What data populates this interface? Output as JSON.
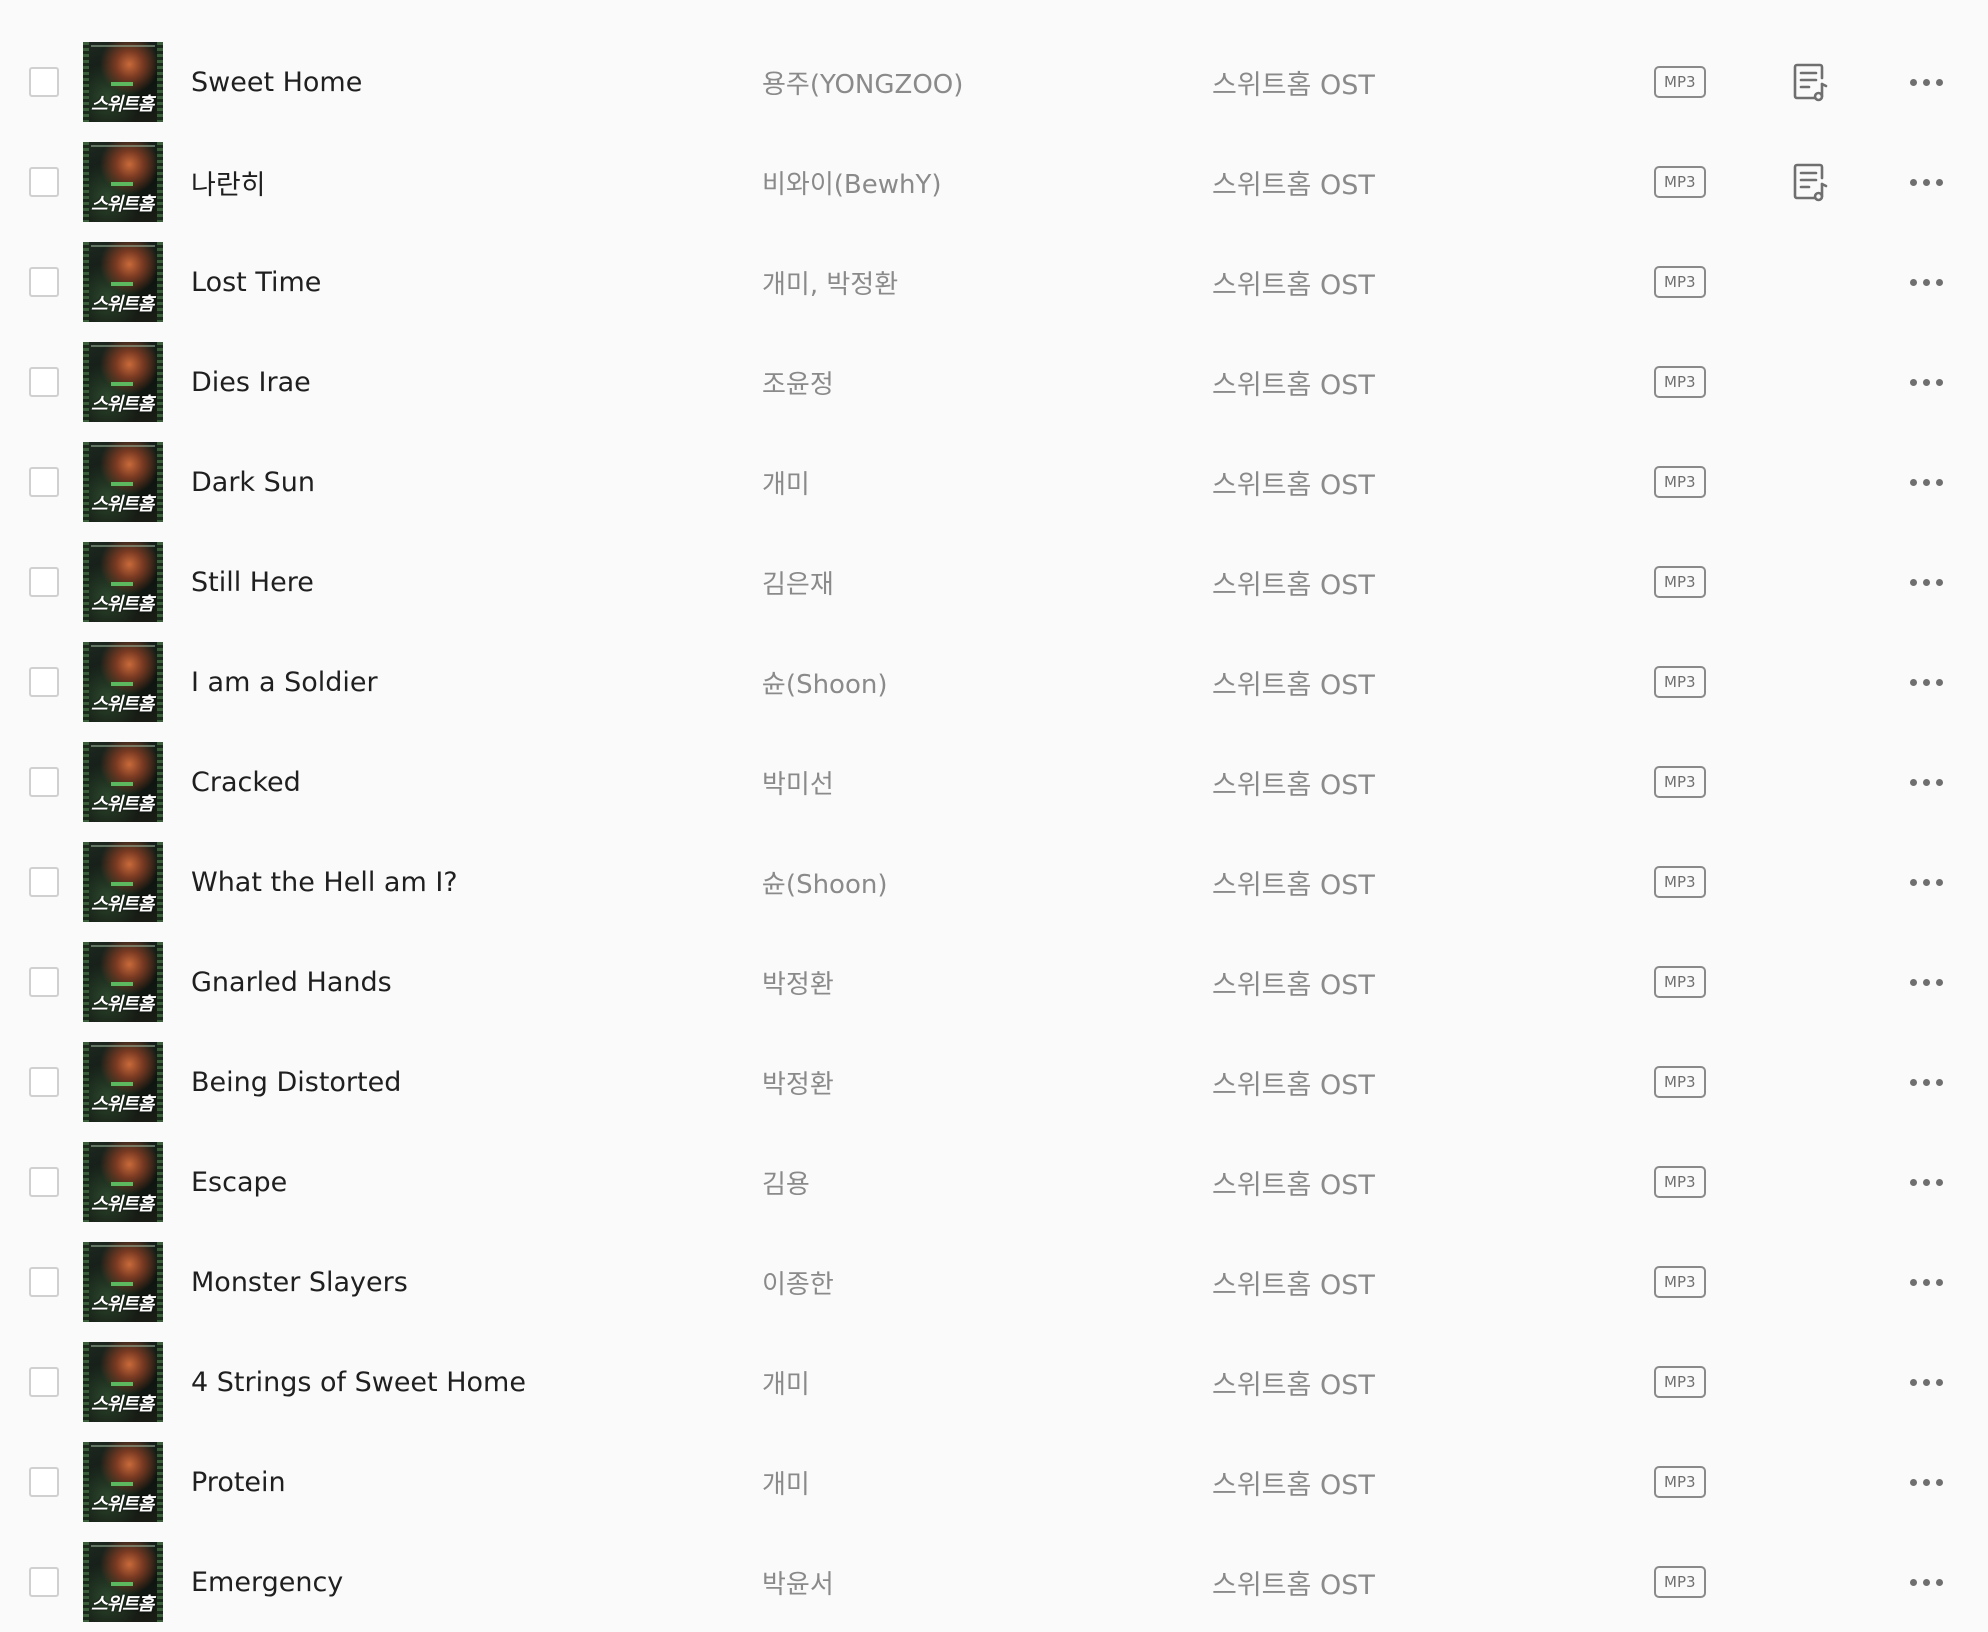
{
  "tracks": [
    {
      "title": "Sweet Home",
      "artist": "용주(YONGZOO)",
      "album": "스위트홈 OST",
      "format": "MP3",
      "has_lyrics": true
    },
    {
      "title": "나란히",
      "artist": "비와이(BewhY)",
      "album": "스위트홈 OST",
      "format": "MP3",
      "has_lyrics": true
    },
    {
      "title": "Lost Time",
      "artist": "개미, 박정환",
      "album": "스위트홈 OST",
      "format": "MP3",
      "has_lyrics": false
    },
    {
      "title": "Dies Irae",
      "artist": "조윤정",
      "album": "스위트홈 OST",
      "format": "MP3",
      "has_lyrics": false
    },
    {
      "title": "Dark Sun",
      "artist": "개미",
      "album": "스위트홈 OST",
      "format": "MP3",
      "has_lyrics": false
    },
    {
      "title": "Still Here",
      "artist": "김은재",
      "album": "스위트홈 OST",
      "format": "MP3",
      "has_lyrics": false
    },
    {
      "title": "I am a Soldier",
      "artist": "슌(Shoon)",
      "album": "스위트홈 OST",
      "format": "MP3",
      "has_lyrics": false
    },
    {
      "title": "Cracked",
      "artist": "박미선",
      "album": "스위트홈 OST",
      "format": "MP3",
      "has_lyrics": false
    },
    {
      "title": "What the Hell am I?",
      "artist": "슌(Shoon)",
      "album": "스위트홈 OST",
      "format": "MP3",
      "has_lyrics": false
    },
    {
      "title": "Gnarled Hands",
      "artist": "박정환",
      "album": "스위트홈 OST",
      "format": "MP3",
      "has_lyrics": false
    },
    {
      "title": "Being Distorted",
      "artist": "박정환",
      "album": "스위트홈 OST",
      "format": "MP3",
      "has_lyrics": false
    },
    {
      "title": "Escape",
      "artist": "김용",
      "album": "스위트홈 OST",
      "format": "MP3",
      "has_lyrics": false
    },
    {
      "title": "Monster Slayers",
      "artist": "이종한",
      "album": "스위트홈 OST",
      "format": "MP3",
      "has_lyrics": false
    },
    {
      "title": "4 Strings of Sweet Home",
      "artist": "개미",
      "album": "스위트홈 OST",
      "format": "MP3",
      "has_lyrics": false
    },
    {
      "title": "Protein",
      "artist": "개미",
      "album": "스위트홈 OST",
      "format": "MP3",
      "has_lyrics": false
    },
    {
      "title": "Emergency",
      "artist": "박윤서",
      "album": "스위트홈 OST",
      "format": "MP3",
      "has_lyrics": false
    }
  ],
  "cover_art_text": "스위트홈",
  "icons": {
    "lyrics": "lyrics-icon",
    "more": "more-options-icon",
    "checkbox": "checkbox"
  },
  "colors": {
    "background": "#fafafa",
    "title_text": "#1f1f1f",
    "secondary_text": "#8a8a8a",
    "badge_border": "#8a8a8a"
  }
}
